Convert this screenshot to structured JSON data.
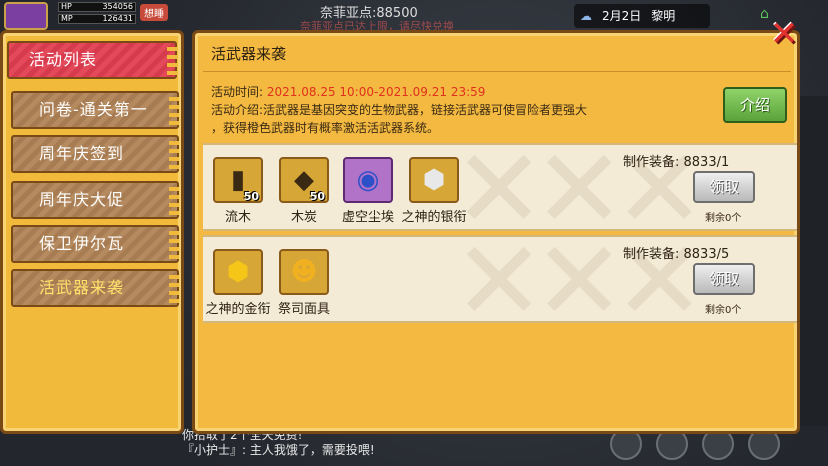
{
  "hud": {
    "hp_label": "HP",
    "hp_value": "354056",
    "mp_label": "MP",
    "mp_value": "126431",
    "player_tag": "想睡",
    "server_line": "奈菲亚点:88500",
    "server_line2": "奈菲亚点已达上限，请尽快兑换",
    "date": "2月2日",
    "time_of_day": "黎明",
    "chat_line1": "你拾取了2个全天免费!",
    "chat_line2": "『小护士』: 主人我饿了，需要投喂!"
  },
  "tabs": [
    {
      "label": "活动列表",
      "state": "active"
    },
    {
      "label": "问卷-通关第一",
      "state": "inactive"
    },
    {
      "label": "周年庆签到",
      "state": "inactive"
    },
    {
      "label": "周年庆大促",
      "state": "inactive"
    },
    {
      "label": "保卫伊尔瓦",
      "state": "inactive"
    },
    {
      "label": "活武器来袭",
      "state": "highlight"
    }
  ],
  "event": {
    "title": "活武器来袭",
    "time_label": "活动时间:",
    "time_value": "2021.08.25 10:00-2021.09.21 23:59",
    "intro_label": "活动介绍:",
    "intro_text_1": "活武器是基因突变的生物武器，链接活武器可使冒险者更强大",
    "intro_text_2": "，获得橙色武器时有概率激活活武器系统。",
    "intro_button": "介绍"
  },
  "recipes": [
    {
      "items": [
        {
          "name": "流木",
          "count": "50",
          "icon": "wood-icon",
          "rarity": "gold"
        },
        {
          "name": "木炭",
          "count": "50",
          "icon": "charcoal-icon",
          "rarity": "gold"
        },
        {
          "name": "虚空尘埃",
          "count": "",
          "icon": "void-dust-icon",
          "rarity": "purple"
        },
        {
          "name": "之神的银衔",
          "count": "",
          "icon": "silver-emblem-icon",
          "rarity": "gold"
        }
      ],
      "requirement": "制作装备: 8833/1",
      "claim_label": "领取",
      "remaining": "剩余0个"
    },
    {
      "items": [
        {
          "name": "之神的金衔",
          "count": "",
          "icon": "gold-emblem-icon",
          "rarity": "gold"
        },
        {
          "name": "祭司面具",
          "count": "",
          "icon": "priest-mask-icon",
          "rarity": "gold"
        }
      ],
      "requirement": "制作装备: 8833/5",
      "claim_label": "领取",
      "remaining": "剩余0个"
    }
  ],
  "colors": {
    "panel": "#f3b941",
    "active_tab": "#e4495a",
    "accent_red": "#e0301e",
    "intro_button": "#6cb84a"
  }
}
